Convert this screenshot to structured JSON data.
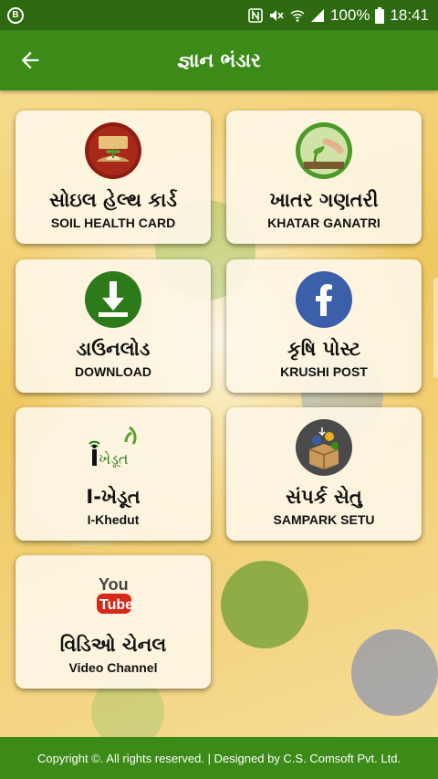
{
  "status_bar": {
    "left_icon": "b-notification-icon",
    "battery": "100%",
    "time": "18:41",
    "icons": [
      "nfc-icon",
      "mute-icon",
      "wifi-icon",
      "signal-icon",
      "battery-icon"
    ]
  },
  "app_bar": {
    "title": "જ્ઞાન ભંડાર",
    "back_icon": "back-arrow-icon"
  },
  "cards": [
    {
      "gu": "સોઇલ હેલ્થ કાર્ડ",
      "en": "SOIL HEALTH CARD",
      "icon": "soil-health-card-icon"
    },
    {
      "gu": "ખાતર ગણતરી",
      "en": "KHATAR GANATRI",
      "icon": "fertilizer-calculation-icon"
    },
    {
      "gu": "ડાઉનલોડ",
      "en": "DOWNLOAD",
      "icon": "download-icon"
    },
    {
      "gu": "કૃષિ પોસ્ટ",
      "en": "KRUSHI POST",
      "icon": "facebook-icon"
    },
    {
      "gu": "I-ખેડૂત",
      "en": "I-Khedut",
      "icon": "i-khedut-logo-icon"
    },
    {
      "gu": "સંપર્ક સેતુ",
      "en": "SAMPARK SETU",
      "icon": "sampark-setu-box-icon"
    },
    {
      "gu": "વિડિઓ ચેનલ",
      "en": "Video Channel",
      "icon": "youtube-icon"
    }
  ],
  "footer": {
    "text": "Copyright ©. All rights reserved. | Designed by C.S. Comsoft Pvt. Ltd."
  },
  "colors": {
    "status_bar": "#2f6a12",
    "app_bar": "#3c8a17",
    "footer": "#3c8a17",
    "card_bg": "#fdf6e6",
    "background": "#f4d27a"
  }
}
